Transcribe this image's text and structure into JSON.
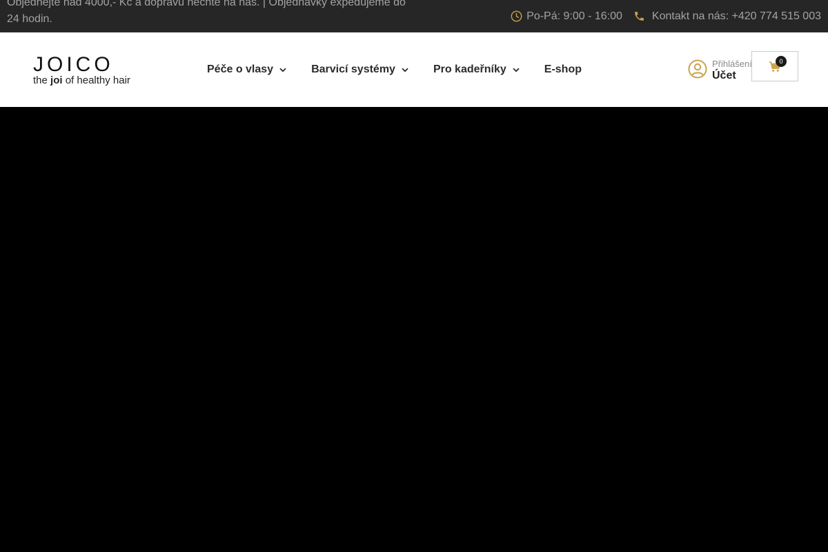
{
  "topbar": {
    "promo": "Objednejte nad 4000,- Kč a dopravu nechte na nás. | Objednávky expedujeme do 24 hodin.",
    "hours": "Po-Pá: 9:00 - 16:00",
    "contact": "Kontakt na nás: +420 774 515 003"
  },
  "brand": {
    "logo_word": "JOICO",
    "tagline_pre": "the",
    "tagline_bold": "joi",
    "tagline_post": "of healthy hair"
  },
  "nav": {
    "items": [
      {
        "label": "Péče o vlasy",
        "dropdown": true
      },
      {
        "label": "Barvicí systémy",
        "dropdown": true
      },
      {
        "label": "Pro kadeřníky",
        "dropdown": true
      },
      {
        "label": "E-shop",
        "dropdown": false
      }
    ]
  },
  "account": {
    "sub_label": "Přihlášení",
    "main_label": "Účet"
  },
  "cart": {
    "count": "0"
  },
  "colors": {
    "accent_gold": "#c9a24a",
    "topbar_bg": "#262626",
    "hero_bg": "#000000"
  },
  "icons": {
    "hours": "clock-icon",
    "contact": "phone-icon",
    "account": "user-circle-icon",
    "cart": "cart-icon",
    "dropdown": "chevron-down-icon"
  }
}
